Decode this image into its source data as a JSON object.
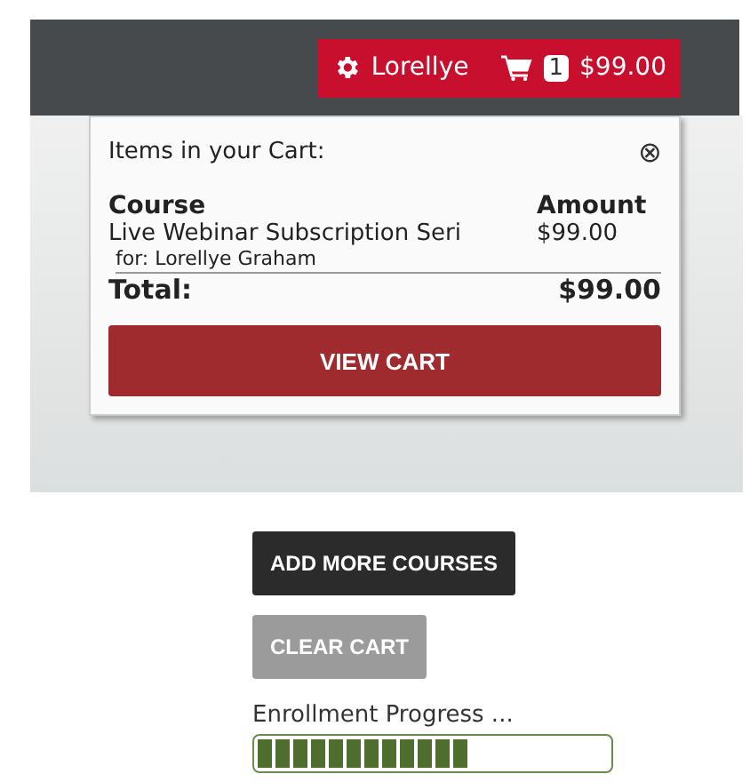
{
  "header": {
    "user": "Lorellye",
    "cart_count": "1",
    "cart_total": "$99.00"
  },
  "cart_popup": {
    "title": "Items in your Cart:",
    "close": "⊗",
    "columns": [
      "Course",
      "Amount"
    ],
    "items": [
      {
        "course": "Live Webinar Subscription Seri",
        "amount": "$99.00",
        "for": "for: Lorellye Graham"
      }
    ],
    "total_label": "Total:",
    "total": "$99.00",
    "button": "VIEW CART"
  },
  "actions": [
    {
      "label": "ADD MORE COURSES",
      "kind": "primary"
    },
    {
      "label": "CLEAR CART",
      "kind": "secondary"
    }
  ],
  "progress": {
    "label": "Enrollment Progress ...",
    "level": 0.6
  }
}
